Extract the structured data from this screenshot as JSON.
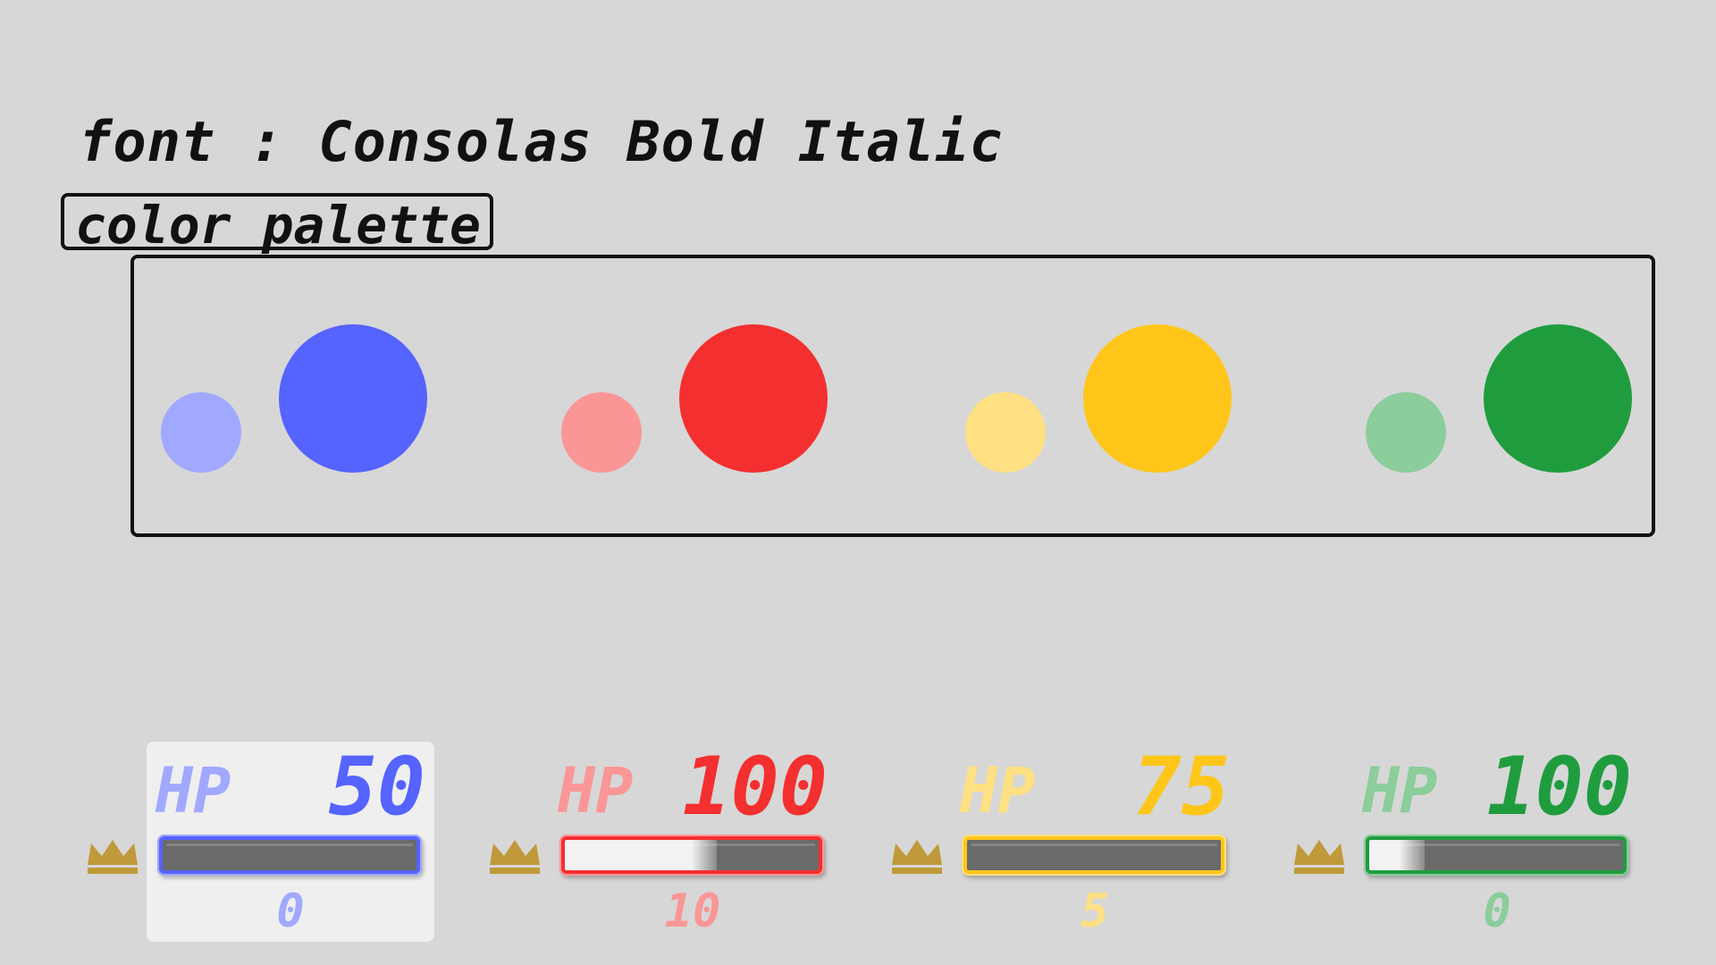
{
  "header": {
    "font_line": "font : Consolas Bold Italic",
    "palette_label": "color palette"
  },
  "palette": [
    {
      "light": "#a1a8ff",
      "dark": "#5563ff"
    },
    {
      "light": "#fa9696",
      "dark": "#f42f2f"
    },
    {
      "light": "#ffe082",
      "dark": "#ffc619"
    },
    {
      "light": "#8bcd9b",
      "dark": "#1f9d3e"
    }
  ],
  "cards": [
    {
      "hp_label": "HP",
      "hp_value": "50",
      "sub_value": "0",
      "fill": 0.0,
      "light": "#a1a8ff",
      "dark": "#5563ff",
      "selected": true
    },
    {
      "hp_label": "HP",
      "hp_value": "100",
      "sub_value": "10",
      "fill": 0.6,
      "light": "#fa9696",
      "dark": "#f42f2f",
      "selected": false
    },
    {
      "hp_label": "HP",
      "hp_value": "75",
      "sub_value": "5",
      "fill": 0.0,
      "light": "#ffe082",
      "dark": "#ffc619",
      "selected": false
    },
    {
      "hp_label": "HP",
      "hp_value": "100",
      "sub_value": "0",
      "fill": 0.22,
      "light": "#8bcd9b",
      "dark": "#1f9d3e",
      "selected": false
    }
  ],
  "crown_color": "#c09a3a"
}
